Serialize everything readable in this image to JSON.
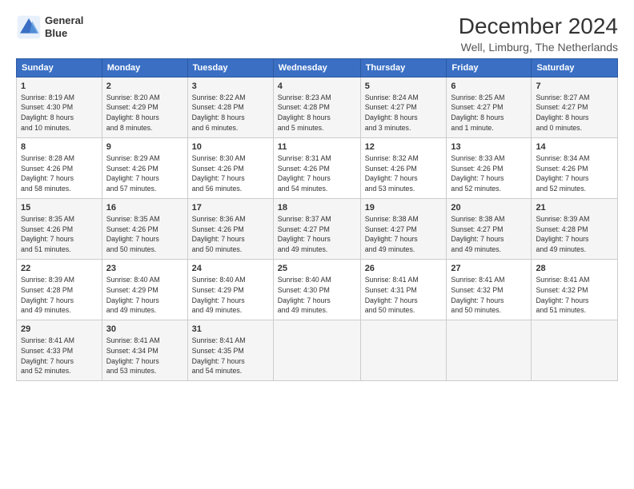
{
  "logo": {
    "line1": "General",
    "line2": "Blue"
  },
  "title": "December 2024",
  "subtitle": "Well, Limburg, The Netherlands",
  "days_of_week": [
    "Sunday",
    "Monday",
    "Tuesday",
    "Wednesday",
    "Thursday",
    "Friday",
    "Saturday"
  ],
  "weeks": [
    [
      {
        "day": "1",
        "detail": "Sunrise: 8:19 AM\nSunset: 4:30 PM\nDaylight: 8 hours\nand 10 minutes."
      },
      {
        "day": "2",
        "detail": "Sunrise: 8:20 AM\nSunset: 4:29 PM\nDaylight: 8 hours\nand 8 minutes."
      },
      {
        "day": "3",
        "detail": "Sunrise: 8:22 AM\nSunset: 4:28 PM\nDaylight: 8 hours\nand 6 minutes."
      },
      {
        "day": "4",
        "detail": "Sunrise: 8:23 AM\nSunset: 4:28 PM\nDaylight: 8 hours\nand 5 minutes."
      },
      {
        "day": "5",
        "detail": "Sunrise: 8:24 AM\nSunset: 4:27 PM\nDaylight: 8 hours\nand 3 minutes."
      },
      {
        "day": "6",
        "detail": "Sunrise: 8:25 AM\nSunset: 4:27 PM\nDaylight: 8 hours\nand 1 minute."
      },
      {
        "day": "7",
        "detail": "Sunrise: 8:27 AM\nSunset: 4:27 PM\nDaylight: 8 hours\nand 0 minutes."
      }
    ],
    [
      {
        "day": "8",
        "detail": "Sunrise: 8:28 AM\nSunset: 4:26 PM\nDaylight: 7 hours\nand 58 minutes."
      },
      {
        "day": "9",
        "detail": "Sunrise: 8:29 AM\nSunset: 4:26 PM\nDaylight: 7 hours\nand 57 minutes."
      },
      {
        "day": "10",
        "detail": "Sunrise: 8:30 AM\nSunset: 4:26 PM\nDaylight: 7 hours\nand 56 minutes."
      },
      {
        "day": "11",
        "detail": "Sunrise: 8:31 AM\nSunset: 4:26 PM\nDaylight: 7 hours\nand 54 minutes."
      },
      {
        "day": "12",
        "detail": "Sunrise: 8:32 AM\nSunset: 4:26 PM\nDaylight: 7 hours\nand 53 minutes."
      },
      {
        "day": "13",
        "detail": "Sunrise: 8:33 AM\nSunset: 4:26 PM\nDaylight: 7 hours\nand 52 minutes."
      },
      {
        "day": "14",
        "detail": "Sunrise: 8:34 AM\nSunset: 4:26 PM\nDaylight: 7 hours\nand 52 minutes."
      }
    ],
    [
      {
        "day": "15",
        "detail": "Sunrise: 8:35 AM\nSunset: 4:26 PM\nDaylight: 7 hours\nand 51 minutes."
      },
      {
        "day": "16",
        "detail": "Sunrise: 8:35 AM\nSunset: 4:26 PM\nDaylight: 7 hours\nand 50 minutes."
      },
      {
        "day": "17",
        "detail": "Sunrise: 8:36 AM\nSunset: 4:26 PM\nDaylight: 7 hours\nand 50 minutes."
      },
      {
        "day": "18",
        "detail": "Sunrise: 8:37 AM\nSunset: 4:27 PM\nDaylight: 7 hours\nand 49 minutes."
      },
      {
        "day": "19",
        "detail": "Sunrise: 8:38 AM\nSunset: 4:27 PM\nDaylight: 7 hours\nand 49 minutes."
      },
      {
        "day": "20",
        "detail": "Sunrise: 8:38 AM\nSunset: 4:27 PM\nDaylight: 7 hours\nand 49 minutes."
      },
      {
        "day": "21",
        "detail": "Sunrise: 8:39 AM\nSunset: 4:28 PM\nDaylight: 7 hours\nand 49 minutes."
      }
    ],
    [
      {
        "day": "22",
        "detail": "Sunrise: 8:39 AM\nSunset: 4:28 PM\nDaylight: 7 hours\nand 49 minutes."
      },
      {
        "day": "23",
        "detail": "Sunrise: 8:40 AM\nSunset: 4:29 PM\nDaylight: 7 hours\nand 49 minutes."
      },
      {
        "day": "24",
        "detail": "Sunrise: 8:40 AM\nSunset: 4:29 PM\nDaylight: 7 hours\nand 49 minutes."
      },
      {
        "day": "25",
        "detail": "Sunrise: 8:40 AM\nSunset: 4:30 PM\nDaylight: 7 hours\nand 49 minutes."
      },
      {
        "day": "26",
        "detail": "Sunrise: 8:41 AM\nSunset: 4:31 PM\nDaylight: 7 hours\nand 50 minutes."
      },
      {
        "day": "27",
        "detail": "Sunrise: 8:41 AM\nSunset: 4:32 PM\nDaylight: 7 hours\nand 50 minutes."
      },
      {
        "day": "28",
        "detail": "Sunrise: 8:41 AM\nSunset: 4:32 PM\nDaylight: 7 hours\nand 51 minutes."
      }
    ],
    [
      {
        "day": "29",
        "detail": "Sunrise: 8:41 AM\nSunset: 4:33 PM\nDaylight: 7 hours\nand 52 minutes."
      },
      {
        "day": "30",
        "detail": "Sunrise: 8:41 AM\nSunset: 4:34 PM\nDaylight: 7 hours\nand 53 minutes."
      },
      {
        "day": "31",
        "detail": "Sunrise: 8:41 AM\nSunset: 4:35 PM\nDaylight: 7 hours\nand 54 minutes."
      },
      {
        "day": "",
        "detail": ""
      },
      {
        "day": "",
        "detail": ""
      },
      {
        "day": "",
        "detail": ""
      },
      {
        "day": "",
        "detail": ""
      }
    ]
  ]
}
